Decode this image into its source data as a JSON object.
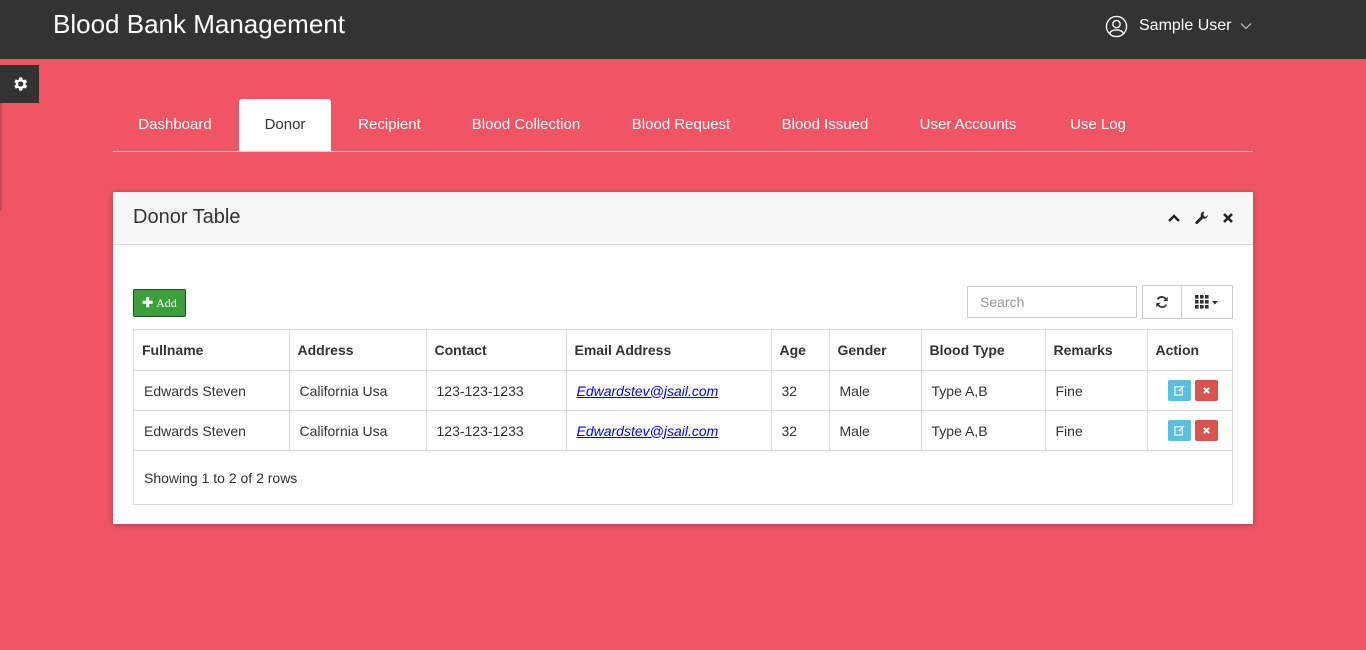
{
  "app": {
    "title": "Blood Bank Management"
  },
  "user": {
    "name": "Sample User"
  },
  "nav": {
    "tabs": [
      {
        "label": "Dashboard"
      },
      {
        "label": "Donor"
      },
      {
        "label": "Recipient"
      },
      {
        "label": "Blood Collection"
      },
      {
        "label": "Blood Request"
      },
      {
        "label": "Blood Issued"
      },
      {
        "label": "User Accounts"
      },
      {
        "label": "Use Log"
      }
    ],
    "active": "Donor"
  },
  "panel": {
    "title": "Donor Table",
    "add_label": "Add",
    "search_placeholder": "Search"
  },
  "table": {
    "columns": [
      "Fullname",
      "Address",
      "Contact",
      "Email Address",
      "Age",
      "Gender",
      "Blood Type",
      "Remarks",
      "Action"
    ],
    "rows": [
      {
        "fullname": "Edwards Steven",
        "address": "California Usa",
        "contact": "123-123-1233",
        "email": "Edwardstev@jsail.com",
        "age": "32",
        "gender": "Male",
        "blood_type": "Type A,B",
        "remarks": "Fine"
      },
      {
        "fullname": "Edwards Steven",
        "address": "California Usa",
        "contact": "123-123-1233",
        "email": "Edwardstev@jsail.com",
        "age": "32",
        "gender": "Male",
        "blood_type": "Type A,B",
        "remarks": "Fine"
      }
    ],
    "footer": "Showing 1 to 2 of 2 rows"
  },
  "colors": {
    "background": "#ef5565",
    "topbar": "#333333",
    "add_button": "#3c9f3c",
    "edit_button": "#5bc0de",
    "delete_button": "#d9534f"
  },
  "icons": {
    "user": "user-circle-icon",
    "dropdown": "chevron-down-icon",
    "settings": "gear-icon",
    "collapse": "chevron-up-icon",
    "configure": "wrench-icon",
    "close": "close-icon",
    "refresh": "refresh-icon",
    "columns": "grid-icon",
    "edit": "edit-icon",
    "delete": "delete-icon"
  }
}
